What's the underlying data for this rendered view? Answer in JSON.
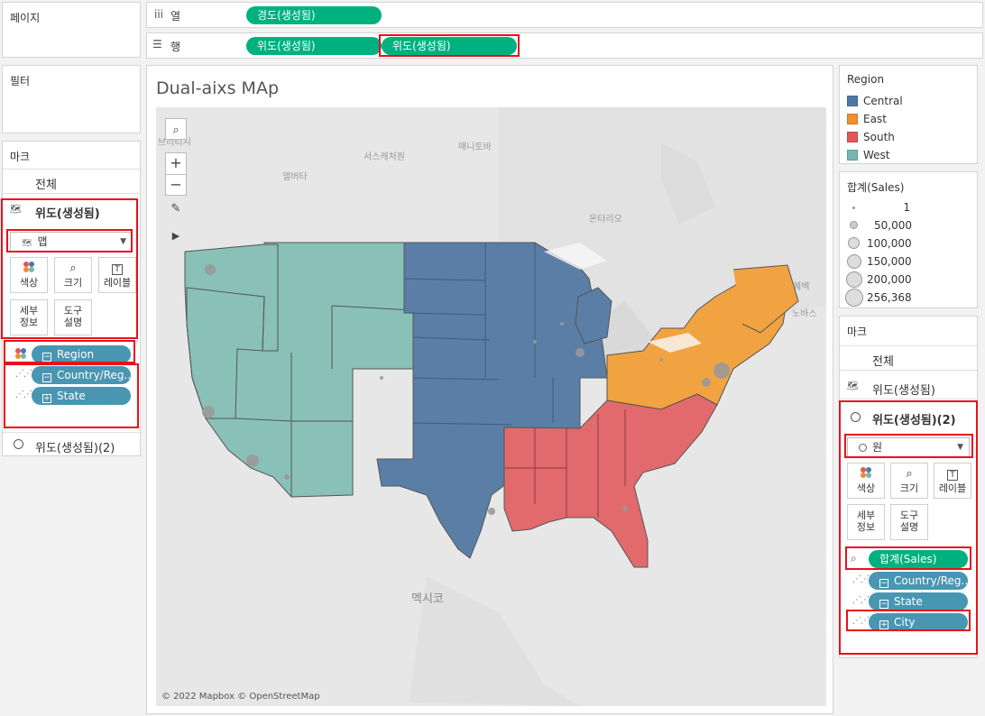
{
  "left_panel": {
    "pages_label": "페이지",
    "filters_label": "필터",
    "marks_label": "마크",
    "all_label": "전체",
    "layer1_label": "위도(생성됨)",
    "mark_type": "맵",
    "buttons": {
      "color": "색상",
      "size": "크기",
      "label": "레이블",
      "detail_1": "세부",
      "detail_2": "정보",
      "tooltip_1": "도구",
      "tooltip_2": "설명"
    },
    "fields": [
      "Region",
      "Country/Reg..",
      "State"
    ],
    "layer2_label": "위도(생성됨)(2)"
  },
  "shelves": {
    "columns_label": "열",
    "rows_label": "행",
    "columns_pill": "경도(생성됨)",
    "rows_pills": [
      "위도(생성됨)",
      "위도(생성됨)"
    ]
  },
  "view": {
    "title": "Dual-aixs MAp",
    "attribution": "© 2022 Mapbox © OpenStreetMap",
    "map_labels": [
      "매니토바",
      "서스캐처원",
      "앨버타",
      "온타리오",
      "멕시코",
      "브리티시",
      "퀘벡",
      "노바스"
    ]
  },
  "legend_region": {
    "title": "Region",
    "items": [
      {
        "label": "Central",
        "color": "#4e79a7"
      },
      {
        "label": "East",
        "color": "#f28e2b"
      },
      {
        "label": "South",
        "color": "#e15759"
      },
      {
        "label": "West",
        "color": "#76b7b2"
      }
    ]
  },
  "legend_sales": {
    "title": "합계(Sales)",
    "items": [
      "1",
      "50,000",
      "100,000",
      "150,000",
      "200,000",
      "256,368"
    ]
  },
  "right_panel": {
    "marks_label": "마크",
    "all_label": "전체",
    "layer1_label": "위도(생성됨)",
    "layer2_label": "위도(생성됨)(2)",
    "mark_type": "원",
    "buttons": {
      "color": "색상",
      "size": "크기",
      "label": "레이블",
      "detail_1": "세부",
      "detail_2": "정보",
      "tooltip_1": "도구",
      "tooltip_2": "설명"
    },
    "fields": [
      "합계(Sales)",
      "Country/Reg..",
      "State",
      "City"
    ]
  }
}
